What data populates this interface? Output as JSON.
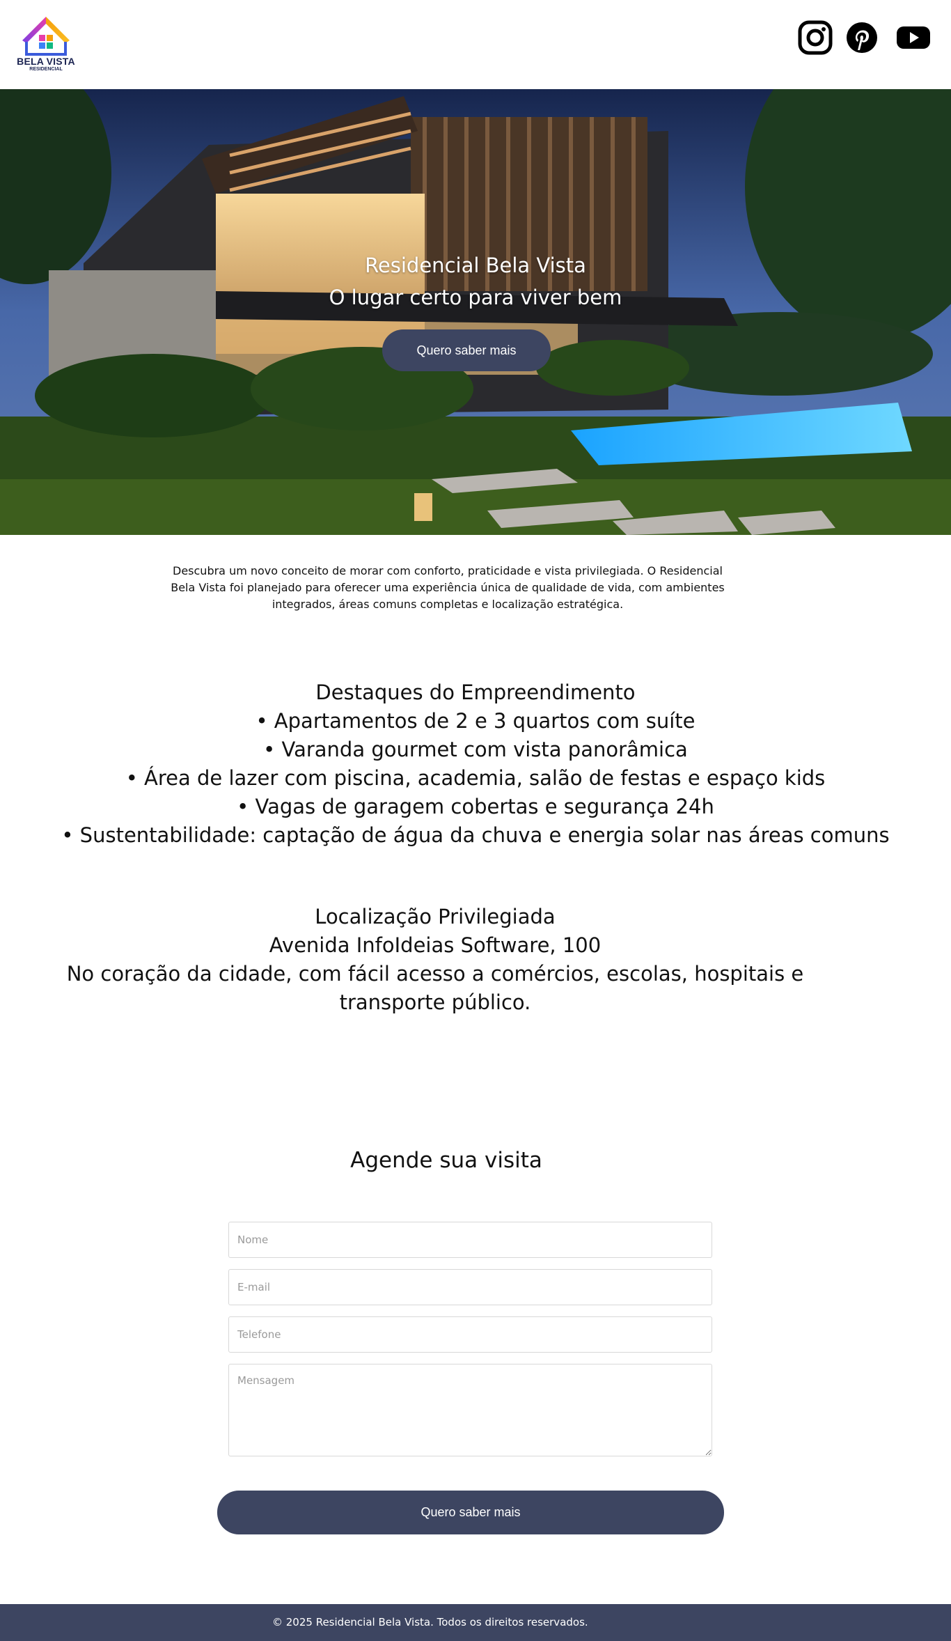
{
  "header": {
    "logo_name": "BELA VISTA",
    "logo_sub": "RESIDENCIAL",
    "social": [
      {
        "name": "instagram-icon"
      },
      {
        "name": "pinterest-icon"
      },
      {
        "name": "youtube-icon"
      }
    ]
  },
  "hero": {
    "title": "Residencial Bela Vista",
    "subtitle": "O lugar certo para viver bem",
    "button_label": "Quero saber mais"
  },
  "intro": {
    "text": "Descubra um novo conceito de morar com conforto, praticidade e vista privilegiada. O Residencial Bela Vista foi planejado para oferecer uma experiência única de qualidade de vida, com ambientes integrados, áreas comuns completas e localização estratégica."
  },
  "highlights": {
    "title": "Destaques do Empreendimento",
    "items": [
      "• Apartamentos de 2 e 3 quartos com suíte",
      "• Varanda gourmet com vista panorâmica",
      "• Área de lazer com piscina, academia, salão de festas e espaço kids",
      "• Vagas de garagem cobertas e segurança 24h",
      "• Sustentabilidade: captação de água da chuva e energia solar nas áreas comuns"
    ]
  },
  "location": {
    "title": "Localização Privilegiada",
    "address": "Avenida InfoIdeias Software, 100",
    "description": "No coração da cidade, com fácil acesso a comércios, escolas, hospitais e transporte público."
  },
  "form": {
    "title": "Agende sua visita",
    "name_placeholder": "Nome",
    "email_placeholder": "E-mail",
    "phone_placeholder": "Telefone",
    "message_placeholder": "Mensagem",
    "submit_label": "Quero saber mais"
  },
  "footer": {
    "text": "© 2025 Residencial Bela Vista. Todos os direitos reservados."
  },
  "colors": {
    "accent": "#3d4561",
    "footer_bg": "#3d4561"
  }
}
